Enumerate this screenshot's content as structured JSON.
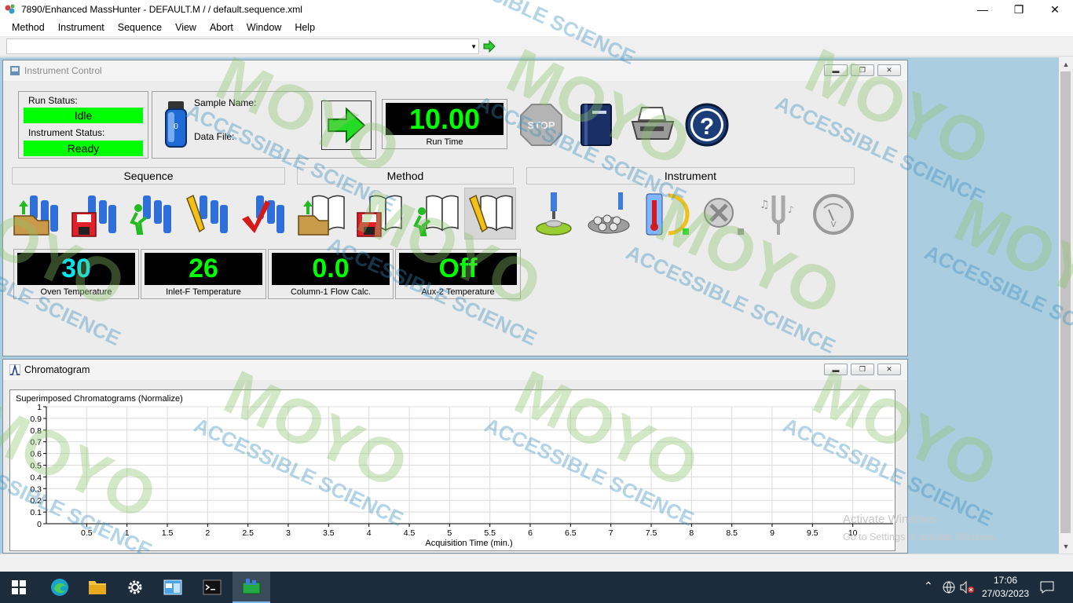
{
  "window": {
    "title": "7890/Enhanced MassHunter - DEFAULT.M /  / default.sequence.xml"
  },
  "menu": [
    "Method",
    "Instrument",
    "Sequence",
    "View",
    "Abort",
    "Window",
    "Help"
  ],
  "instrument_control": {
    "title": "Instrument Control",
    "run_status_label": "Run Status:",
    "run_status": "Idle",
    "instrument_status_label": "Instrument Status:",
    "instrument_status": "Ready",
    "vial_number": "0",
    "sample_name_label": "Sample Name:",
    "data_file_label": "Data File:",
    "run_time": "10.00",
    "run_time_label": "Run Time",
    "stop_label": "STOP",
    "sections": {
      "sequence": "Sequence",
      "method": "Method",
      "instrument": "Instrument"
    },
    "readouts": [
      {
        "value": "30",
        "label": "Oven Temperature",
        "color": "#00e5ee"
      },
      {
        "value": "26",
        "label": "Inlet-F Temperature",
        "color": "#00ff00"
      },
      {
        "value": "0.0",
        "label": "Column-1 Flow Calc.",
        "color": "#00ff00"
      },
      {
        "value": "Off",
        "label": "Aux-2 Temperature",
        "color": "#00ff00"
      }
    ]
  },
  "chromatogram": {
    "title": "Chromatogram",
    "plot_title": "Superimposed Chromatograms (Normalize)"
  },
  "chart_data": {
    "type": "line",
    "title": "Superimposed Chromatograms (Normalize)",
    "xlabel": "Acquisition Time (min.)",
    "ylabel": "",
    "xlim": [
      0,
      10.5
    ],
    "ylim": [
      0,
      1
    ],
    "x_ticks": [
      "0.5",
      "1",
      "1.5",
      "2",
      "2.5",
      "3",
      "3.5",
      "4",
      "4.5",
      "5",
      "5.5",
      "6",
      "6.5",
      "7",
      "7.5",
      "8",
      "8.5",
      "9",
      "9.5",
      "10"
    ],
    "y_ticks": [
      "0",
      "0.1",
      "0.2",
      "0.3",
      "0.4",
      "0.5",
      "0.6",
      "0.7",
      "0.8",
      "0.9",
      "1"
    ],
    "grid": true,
    "series": []
  },
  "watermark": {
    "brand": "MOYO",
    "tagline": "ACCESSIBLE SCIENCE"
  },
  "activation": {
    "line1": "Activate Windows",
    "line2": "Go to Settings to activate Windows."
  },
  "taskbar": {
    "time": "17:06",
    "date": "27/03/2023"
  }
}
